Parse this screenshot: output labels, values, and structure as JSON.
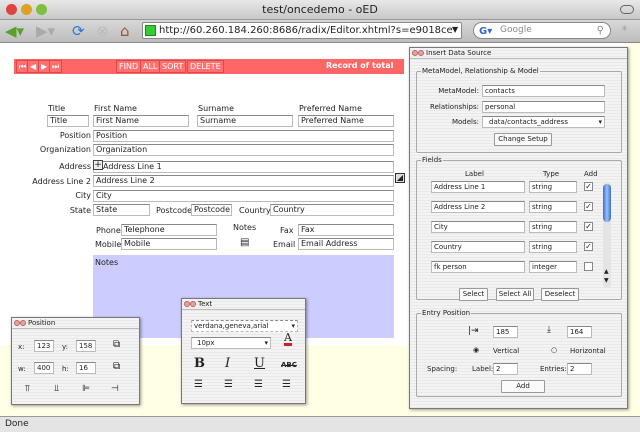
{
  "window": {
    "title": "test/oncedemo - oED"
  },
  "toolbar": {
    "url": "http://60.260.184.260:8686/radix/Editor.xhtml?s=e9018ce",
    "search_placeholder": "Google"
  },
  "record_bar": {
    "nav": [
      "⏮",
      "◀",
      "▶",
      "⏭"
    ],
    "buttons": [
      "FIND",
      "ALL",
      "SORT",
      "DELETE"
    ],
    "status": "Record of  total"
  },
  "form": {
    "labels": {
      "title": "Title",
      "first": "First Name",
      "surname": "Surname",
      "preferred": "Preferred Name",
      "position": "Position",
      "organization": "Organization",
      "address": "Address",
      "address2": "Address Line 2",
      "city": "City",
      "state": "State",
      "postcode": "Postcode",
      "country": "Country",
      "phone": "Phone",
      "mobile": "Mobile",
      "notes": "Notes",
      "fax": "Fax",
      "email": "Email"
    },
    "values": {
      "title": "Title",
      "first": "First Name",
      "surname": "Surname",
      "preferred": "Preferred Name",
      "position": "Position",
      "organization": "Organization",
      "address": "Address Line 1",
      "address2": "Address Line 2",
      "city": "City",
      "state": "State",
      "postcode": "Postcode",
      "country": "Country",
      "phone": "Telephone",
      "mobile": "Mobile",
      "fax": "Fax",
      "email": "Email Address",
      "notes": "Notes"
    },
    "notes_color": "#ccccff"
  },
  "insert_panel": {
    "title": "Insert Data Source",
    "meta_group": "MetaModel, Relationship & Model",
    "metamodel_label": "MetaModel:",
    "metamodel": "contacts",
    "relationships_label": "Relationships:",
    "relationships": "personal",
    "models_label": "Models:",
    "model": "data/contacts_address",
    "change_setup": "Change Setup",
    "fields_group": "Fields",
    "col_label": "Label",
    "col_type": "Type",
    "col_add": "Add",
    "fields": [
      {
        "label": "Address Line 1",
        "type": "string",
        "add": true
      },
      {
        "label": "Address Line 2",
        "type": "string",
        "add": true
      },
      {
        "label": "City",
        "type": "string",
        "add": true
      },
      {
        "label": "Country",
        "type": "string",
        "add": true
      },
      {
        "label": "fk person",
        "type": "integer",
        "add": false
      }
    ],
    "select": "Select",
    "select_all": "Select All",
    "deselect": "Deselect",
    "entry_group": "Entry Position",
    "x": "185",
    "y": "164",
    "vertical": "Vertical",
    "horizontal": "Horizontal",
    "orientation": "Vertical",
    "spacing": "Spacing:",
    "label_lbl": "Label:",
    "label_val": "2",
    "entries_lbl": "Entries:",
    "entries_val": "2",
    "add": "Add"
  },
  "position_panel": {
    "title": "Position",
    "x_lbl": "x:",
    "x": "123",
    "y_lbl": "y:",
    "y": "158",
    "w_lbl": "w:",
    "w": "400",
    "h_lbl": "h:",
    "h": "16"
  },
  "text_panel": {
    "title": "Text",
    "font": "verdana,geneva,arial",
    "size": "10px",
    "bold": "B",
    "italic": "I",
    "underline": "U",
    "strike": "ABC",
    "color": "#cc2222"
  },
  "status": "Done"
}
